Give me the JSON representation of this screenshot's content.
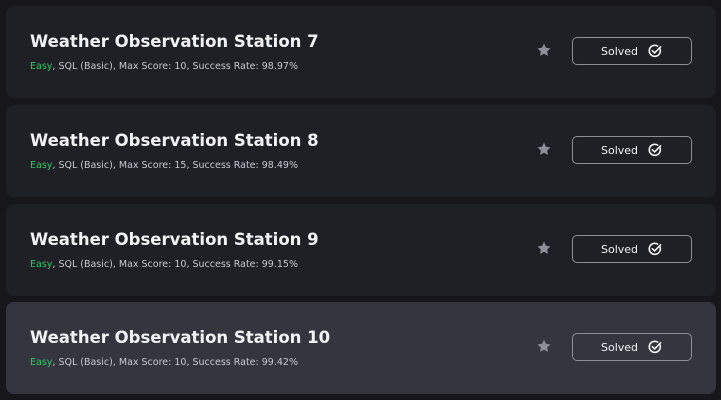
{
  "challenges": [
    {
      "title": "Weather Observation Station 7",
      "difficulty": "Easy",
      "details": ", SQL (Basic), Max Score: 10, Success Rate: 98.97%",
      "status_label": "Solved"
    },
    {
      "title": "Weather Observation Station 8",
      "difficulty": "Easy",
      "details": ", SQL (Basic), Max Score: 15, Success Rate: 98.49%",
      "status_label": "Solved"
    },
    {
      "title": "Weather Observation Station 9",
      "difficulty": "Easy",
      "details": ", SQL (Basic), Max Score: 10, Success Rate: 99.15%",
      "status_label": "Solved"
    },
    {
      "title": "Weather Observation Station 10",
      "difficulty": "Easy",
      "details": ", SQL (Basic), Max Score: 10, Success Rate: 99.42%",
      "status_label": "Solved"
    }
  ],
  "colors": {
    "page_background": "#16161b",
    "card_background": "#1f1f26",
    "card_hover_background": "#35353f",
    "difficulty_easy": "#2ec866",
    "text_primary": "#f2f2f4",
    "text_secondary": "#c8c8d0",
    "star_icon": "#8e8e98",
    "button_border": "#8e8e98"
  },
  "icons": {
    "bookmark": "star-icon",
    "status": "check-circle-icon"
  }
}
